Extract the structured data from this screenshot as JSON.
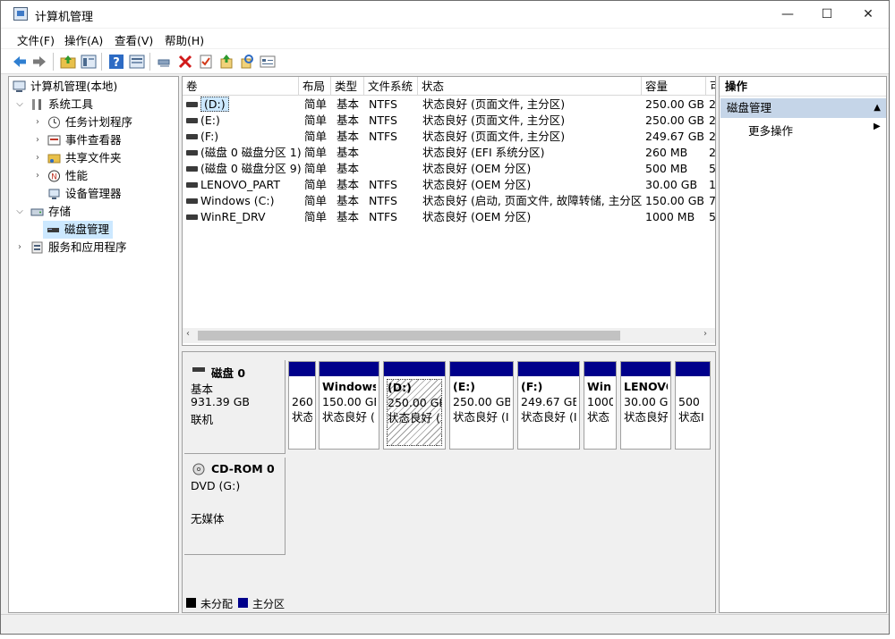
{
  "window": {
    "title": "计算机管理",
    "minimize": "—",
    "maximize": "☐",
    "close": "✕"
  },
  "menu": [
    "文件(F)",
    "操作(A)",
    "查看(V)",
    "帮助(H)"
  ],
  "toolbar_icons": [
    "back-arrow-icon",
    "forward-arrow-icon",
    "up-folder-icon",
    "show-hide-tree-icon",
    "help-icon",
    "properties-icon",
    "connect-icon",
    "delete-icon",
    "checklist-icon",
    "import-icon",
    "search-icon",
    "list-view-icon"
  ],
  "tree": {
    "root": "计算机管理(本地)",
    "system_tools": "系统工具",
    "task_scheduler": "任务计划程序",
    "event_viewer": "事件查看器",
    "shared_folders": "共享文件夹",
    "performance": "性能",
    "device_manager": "设备管理器",
    "storage": "存储",
    "disk_management": "磁盘管理",
    "services": "服务和应用程序"
  },
  "columns": [
    "卷",
    "布局",
    "类型",
    "文件系统",
    "状态",
    "容量",
    "可"
  ],
  "volumes": [
    {
      "name": "(D:)",
      "layout": "简单",
      "type": "基本",
      "fs": "NTFS",
      "status": "状态良好 (页面文件, 主分区)",
      "capacity": "250.00 GB",
      "free": "2"
    },
    {
      "name": "(E:)",
      "layout": "简单",
      "type": "基本",
      "fs": "NTFS",
      "status": "状态良好 (页面文件, 主分区)",
      "capacity": "250.00 GB",
      "free": "2"
    },
    {
      "name": "(F:)",
      "layout": "简单",
      "type": "基本",
      "fs": "NTFS",
      "status": "状态良好 (页面文件, 主分区)",
      "capacity": "249.67 GB",
      "free": "2"
    },
    {
      "name": "(磁盘 0 磁盘分区 1)",
      "layout": "简单",
      "type": "基本",
      "fs": "",
      "status": "状态良好 (EFI 系统分区)",
      "capacity": "260 MB",
      "free": "2"
    },
    {
      "name": "(磁盘 0 磁盘分区 9)",
      "layout": "简单",
      "type": "基本",
      "fs": "",
      "status": "状态良好 (OEM 分区)",
      "capacity": "500 MB",
      "free": "5"
    },
    {
      "name": "LENOVO_PART",
      "layout": "简单",
      "type": "基本",
      "fs": "NTFS",
      "status": "状态良好 (OEM 分区)",
      "capacity": "30.00 GB",
      "free": "1"
    },
    {
      "name": "Windows (C:)",
      "layout": "简单",
      "type": "基本",
      "fs": "NTFS",
      "status": "状态良好 (启动, 页面文件, 故障转储, 主分区)",
      "capacity": "150.00 GB",
      "free": "7"
    },
    {
      "name": "WinRE_DRV",
      "layout": "简单",
      "type": "基本",
      "fs": "NTFS",
      "status": "状态良好 (OEM 分区)",
      "capacity": "1000 MB",
      "free": "5"
    }
  ],
  "disk0": {
    "name": "磁盘 0",
    "type": "基本",
    "size": "931.39 GB",
    "state": "联机",
    "partitions": [
      {
        "title": "",
        "size": "260",
        "status": "状态"
      },
      {
        "title": "Windows",
        "size": "150.00 GE",
        "status": "状态良好 ("
      },
      {
        "title": "(D:)",
        "size": "250.00 GB",
        "status": "状态良好 (I"
      },
      {
        "title": "(E:)",
        "size": "250.00 GB",
        "status": "状态良好 (I"
      },
      {
        "title": "(F:)",
        "size": "249.67 GB",
        "status": "状态良好 (I"
      },
      {
        "title": "Win",
        "size": "1000",
        "status": "状态"
      },
      {
        "title": "LENOVO",
        "size": "30.00 GE",
        "status": "状态良好"
      },
      {
        "title": "",
        "size": "500",
        "status": "状态I"
      }
    ]
  },
  "cdrom": {
    "name": "CD-ROM 0",
    "type": "DVD (G:)",
    "media": "无媒体"
  },
  "legend": {
    "unallocated": "未分配",
    "primary": "主分区",
    "unallocated_color": "#000000",
    "primary_color": "#00008b"
  },
  "actions": {
    "header": "操作",
    "section": "磁盘管理",
    "more": "更多操作"
  }
}
